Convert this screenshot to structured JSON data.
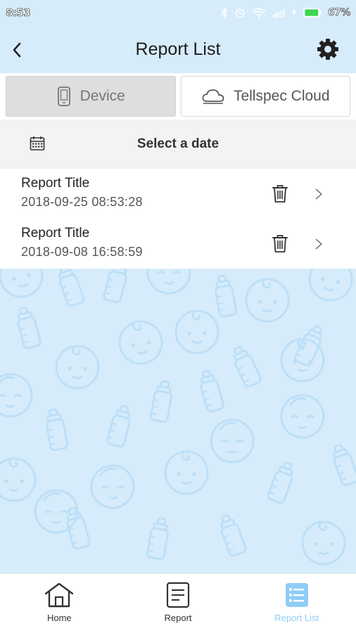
{
  "status_bar": {
    "time": "8:53",
    "battery": "67%",
    "icons": [
      "bluetooth-icon",
      "alarm-icon",
      "wifi-icon",
      "signal-icon",
      "charging-icon",
      "battery-icon"
    ]
  },
  "header": {
    "title": "Report List",
    "back_icon": "chevron-left-icon",
    "settings_icon": "gear-icon"
  },
  "segments": [
    {
      "label": "Device",
      "icon": "phone-icon",
      "active": true
    },
    {
      "label": "Tellspec Cloud",
      "icon": "cloud-icon",
      "active": false
    }
  ],
  "date_filter": {
    "label": "Select a date",
    "icon": "calendar-icon"
  },
  "reports": [
    {
      "title": "Report Title",
      "timestamp": "2018-09-25 08:53:28"
    },
    {
      "title": "Report Title",
      "timestamp": "2018-09-08 16:58:59"
    }
  ],
  "bottom_nav": [
    {
      "label": "Home",
      "icon": "home-icon",
      "active": false
    },
    {
      "label": "Report",
      "icon": "document-icon",
      "active": false
    },
    {
      "label": "Report List",
      "icon": "list-icon",
      "active": true
    }
  ],
  "colors": {
    "header_bg": "#d6ecfb",
    "accent": "#8fcdf7",
    "pattern": "#bcdff7"
  }
}
